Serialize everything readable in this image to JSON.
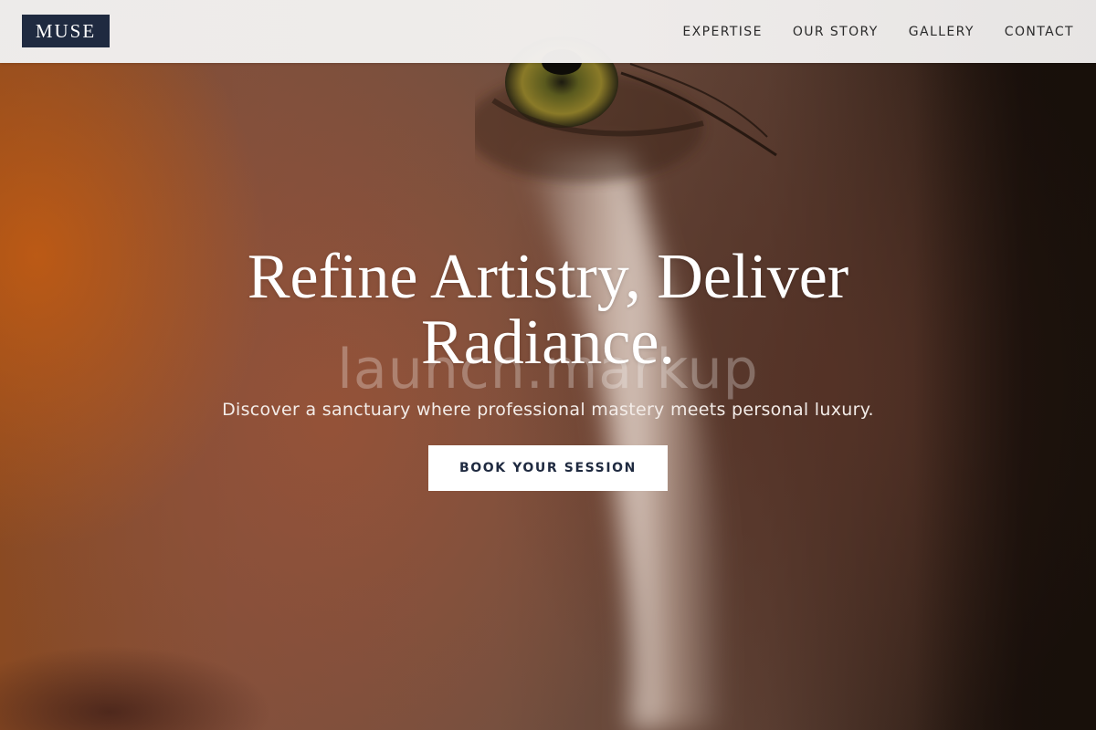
{
  "header": {
    "logo": "MUSE",
    "nav": [
      {
        "label": "EXPERTISE"
      },
      {
        "label": "OUR STORY"
      },
      {
        "label": "GALLERY"
      },
      {
        "label": "CONTACT"
      }
    ]
  },
  "hero": {
    "headline": "Refine Artistry, Deliver Radiance.",
    "subheadline": "Discover a sanctuary where professional mastery meets personal luxury.",
    "cta_label": "BOOK YOUR SESSION",
    "watermark": "launch.markup"
  },
  "colors": {
    "brand_navy": "#1f2a40",
    "header_bg": "#f2f1f0",
    "cta_bg": "#ffffff"
  }
}
